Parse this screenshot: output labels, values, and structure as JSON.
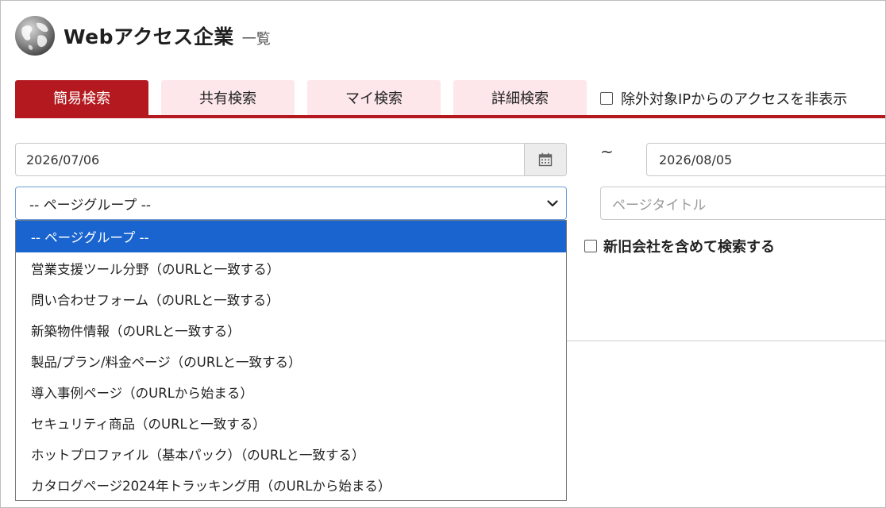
{
  "header": {
    "title": "Webアクセス企業",
    "subtitle": "一覧",
    "logo_icon": "globe-icon"
  },
  "tabs": [
    {
      "label": "簡易検索",
      "active": true
    },
    {
      "label": "共有検索",
      "active": false
    },
    {
      "label": "マイ検索",
      "active": false
    },
    {
      "label": "詳細検索",
      "active": false
    }
  ],
  "exclude_ip": {
    "label": "除外対象IPからのアクセスを非表示",
    "checked": false
  },
  "date_range": {
    "from": "2026/07/06",
    "separator": "~",
    "to": "2026/08/05",
    "calendar_icon": "calendar-icon"
  },
  "page_group": {
    "selected": "-- ページグループ --",
    "options": [
      "-- ページグループ --",
      "営業支援ツール分野（のURLと一致する）",
      "問い合わせフォーム（のURLと一致する）",
      "新築物件情報（のURLと一致する）",
      "製品/プラン/料金ページ（のURLと一致する）",
      "導入事例ページ（のURLから始まる）",
      "セキュリティ商品（のURLと一致する）",
      "ホットプロファイル（基本パック）（のURLと一致する）",
      "カタログページ2024年トラッキング用（のURLから始まる）"
    ]
  },
  "page_title_input": {
    "placeholder": "ページタイトル"
  },
  "include_old_new": {
    "label": "新旧会社を含めて検索する",
    "checked": false
  },
  "colors": {
    "accent": "#b3191e",
    "tab_inactive": "#fde7ea",
    "selected_option": "#1a64d0"
  }
}
